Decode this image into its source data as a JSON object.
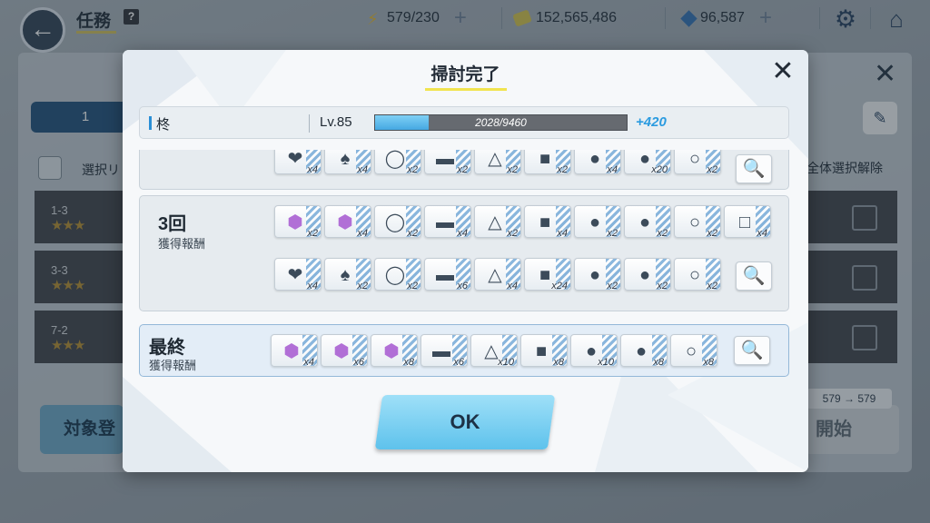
{
  "header": {
    "title": "任務",
    "help": "?",
    "ap": "579/230",
    "credits": "152,565,486",
    "gems": "96,587"
  },
  "background": {
    "tab_label": "1",
    "select_all_label": "選択リ",
    "deselect_label": "全体選択解除",
    "stages": [
      {
        "name": "1-3",
        "stars": "★★★"
      },
      {
        "name": "3-3",
        "stars": "★★★"
      },
      {
        "name": "7-2",
        "stars": "★★★"
      }
    ],
    "register_button": "対象登",
    "start_button": "開始",
    "ap_change": "579 → 579"
  },
  "modal": {
    "title": "掃討完了",
    "character": {
      "name": "柊",
      "level": "Lv.85",
      "exp_text": "2028/9460",
      "exp_progress": 0.2144,
      "exp_gain": "+420"
    },
    "top_row_counts": [
      "x4",
      "x4",
      "x2",
      "x2",
      "x2",
      "x2",
      "x4",
      "x20",
      "x2"
    ],
    "round3": {
      "label": "3回",
      "sub": "獲得報酬",
      "row1_counts": [
        "x2",
        "x4",
        "x2",
        "x4",
        "x2",
        "x4",
        "x2",
        "x2",
        "x2",
        "x4"
      ],
      "row2_counts": [
        "x4",
        "x2",
        "x2",
        "x6",
        "x4",
        "x24",
        "x2",
        "x2",
        "x2"
      ]
    },
    "final": {
      "label": "最終",
      "sub": "獲得報酬",
      "counts": [
        "x4",
        "x6",
        "x8",
        "x6",
        "x10",
        "x8",
        "x10",
        "x8",
        "x8"
      ]
    },
    "ok_label": "OK"
  },
  "colors": {
    "accent_blue": "#2b9be0",
    "ok_button": "#5ec2ec",
    "title_underline": "#f1e44f"
  }
}
